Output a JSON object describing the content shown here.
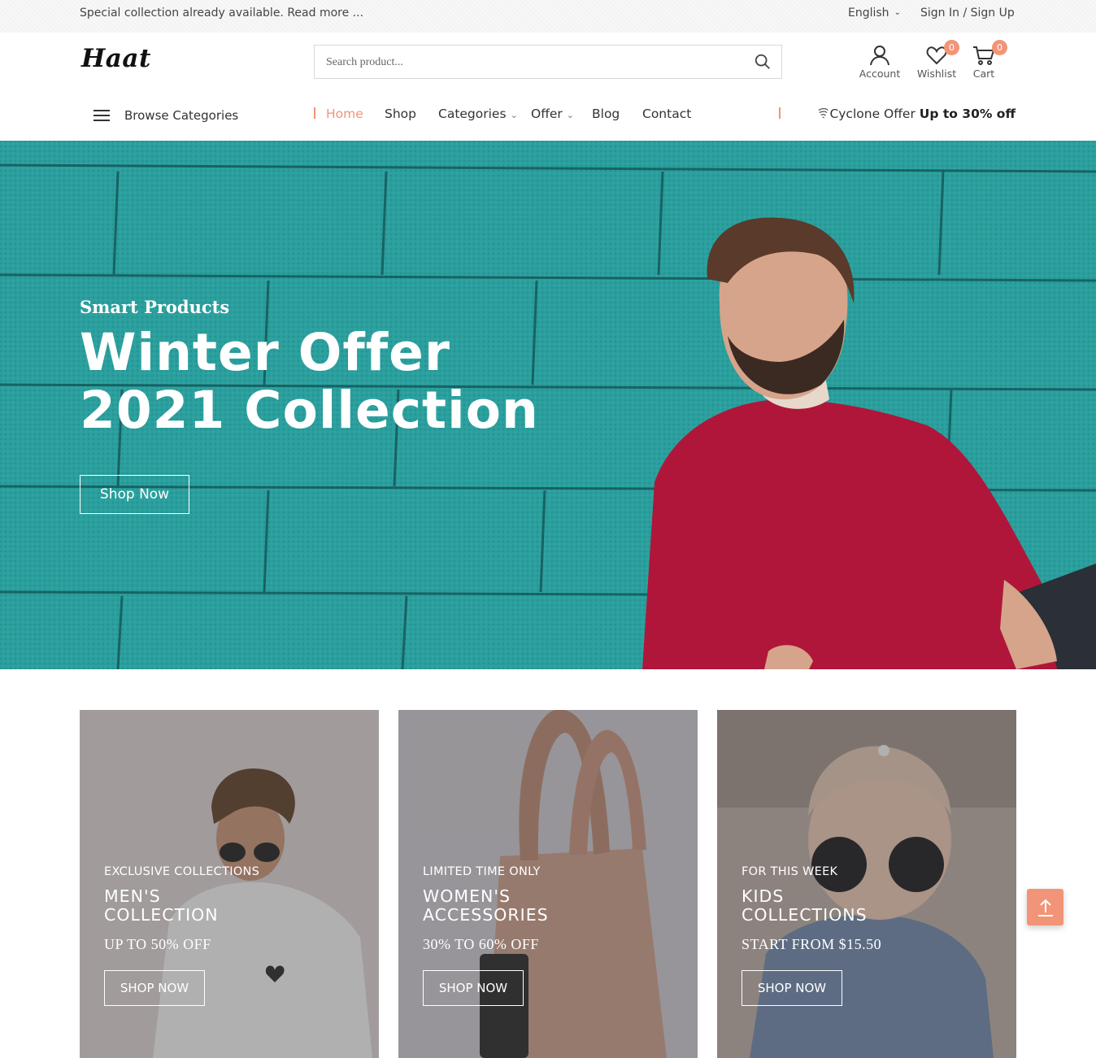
{
  "topbar": {
    "notice": "Special collection already available. Read more ...",
    "language": "English",
    "auth": "Sign In / Sign Up"
  },
  "header": {
    "logo": "Haat",
    "search_placeholder": "Search product...",
    "account_label": "Account",
    "wishlist_label": "Wishlist",
    "wishlist_count": "0",
    "cart_label": "Cart",
    "cart_count": "0"
  },
  "nav": {
    "browse_label": "Browse Categories",
    "items": [
      {
        "label": "Home"
      },
      {
        "label": "Shop"
      },
      {
        "label": "Categories"
      },
      {
        "label": "Offer"
      },
      {
        "label": "Blog"
      },
      {
        "label": "Contact"
      }
    ],
    "offer_prefix": "Cyclone Offer",
    "offer_highlight": "Up to 30% off"
  },
  "hero": {
    "kicker": "Smart Products",
    "title_line1": "Winter Offer",
    "title_line2": "2021 Collection",
    "cta": "Shop Now"
  },
  "collections": [
    {
      "kicker": "EXCLUSIVE COLLECTIONS",
      "title_line1": "MEN'S",
      "title_line2": "COLLECTION",
      "subtitle": "UP TO 50% OFF",
      "cta": "SHOP NOW"
    },
    {
      "kicker": "LIMITED TIME ONLY",
      "title_line1": "WOMEN'S",
      "title_line2": "ACCESSORIES",
      "subtitle": "30% TO 60% OFF",
      "cta": "SHOP NOW"
    },
    {
      "kicker": "FOR THIS WEEK",
      "title_line1": "KIDS",
      "title_line2": "COLLECTIONS",
      "subtitle": "START FROM $15.50",
      "cta": "SHOP NOW"
    }
  ],
  "colors": {
    "accent": "#f29478",
    "hero_wall": "#2a9c9b",
    "sweater": "#b0163a"
  },
  "icons": [
    "search-icon",
    "user-icon",
    "heart-icon",
    "cart-icon",
    "menu-icon",
    "chevron-down-icon",
    "cyclone-icon",
    "arrow-up-icon"
  ]
}
